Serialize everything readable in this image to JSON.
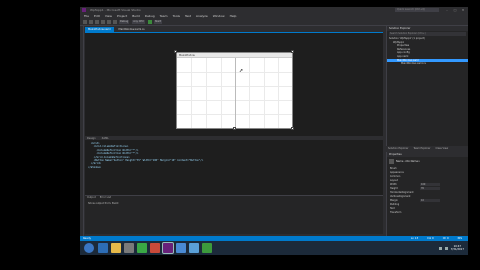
{
  "window": {
    "title": "WpfApp1 - Microsoft Visual Studio",
    "quick_launch": "Quick Launch (Ctrl+Q)"
  },
  "menu": [
    "File",
    "Edit",
    "View",
    "Project",
    "Build",
    "Debug",
    "Team",
    "Tools",
    "Test",
    "Analyze",
    "Window",
    "Help"
  ],
  "toolbar": {
    "config": "Debug",
    "platform": "Any CPU",
    "start": "Start"
  },
  "doc_tabs": [
    {
      "label": "MainWindow.xaml"
    },
    {
      "label": "MainWindow.xaml.cs"
    }
  ],
  "designer": {
    "window_title": "MainWindow"
  },
  "pane_bar": {
    "design": "Design",
    "xaml": "XAML"
  },
  "xaml_lines": [
    "  <Grid>",
    "    <Grid.ColumnDefinitions>",
    "      <ColumnDefinition Width=\"*\"/>",
    "      <ColumnDefinition Width=\"*\"/>",
    "    </Grid.ColumnDefinitions>",
    "    <Button Name=\"button\" Height=\"35\" Width=\"100\" Margin=\"10\" Content=\"Button\"/>",
    "",
    "  </Grid>",
    "</Window>"
  ],
  "output_panel": {
    "tabs": [
      "Output",
      "Error List"
    ],
    "line": "Show output from: Build"
  },
  "solution_explorer": {
    "title": "Solution Explorer",
    "search": "Search Solution Explorer (Ctrl+;)",
    "items": [
      {
        "label": "Solution 'WpfApp1' (1 project)",
        "indent": 0
      },
      {
        "label": "WpfApp1",
        "indent": 1
      },
      {
        "label": "Properties",
        "indent": 2
      },
      {
        "label": "References",
        "indent": 2
      },
      {
        "label": "App.config",
        "indent": 2
      },
      {
        "label": "App.xaml",
        "indent": 2
      },
      {
        "label": "MainWindow.xaml",
        "indent": 2,
        "selected": true
      },
      {
        "label": "MainWindow.xaml.cs",
        "indent": 3
      }
    ],
    "tabs": [
      "Solution Explorer",
      "Team Explorer",
      "Class View"
    ]
  },
  "properties": {
    "title": "Properties",
    "name_label": "Name",
    "name_value": "<No Name>",
    "type": "Button",
    "rows": [
      {
        "k": "Brush",
        "v": ""
      },
      {
        "k": "Appearance",
        "v": ""
      },
      {
        "k": "Common",
        "v": ""
      },
      {
        "k": "Layout",
        "v": ""
      },
      {
        "k": "Width",
        "v": "100"
      },
      {
        "k": "Height",
        "v": "35"
      },
      {
        "k": "HorizontalAlignment",
        "v": ""
      },
      {
        "k": "VerticalAlignment",
        "v": ""
      },
      {
        "k": "Margin",
        "v": "10"
      },
      {
        "k": "Padding",
        "v": ""
      },
      {
        "k": "Text",
        "v": ""
      },
      {
        "k": "Transform",
        "v": ""
      }
    ]
  },
  "status": {
    "left": "Ready",
    "ln": "Ln 13",
    "col": "Col 9",
    "ch": "Ch 9",
    "ins": "INS"
  },
  "clock": {
    "time": "10:47",
    "date": "7/31/2017"
  },
  "colors": {
    "accent": "#007acc",
    "bg": "#2d2d30",
    "editor": "#1e1e1e"
  }
}
